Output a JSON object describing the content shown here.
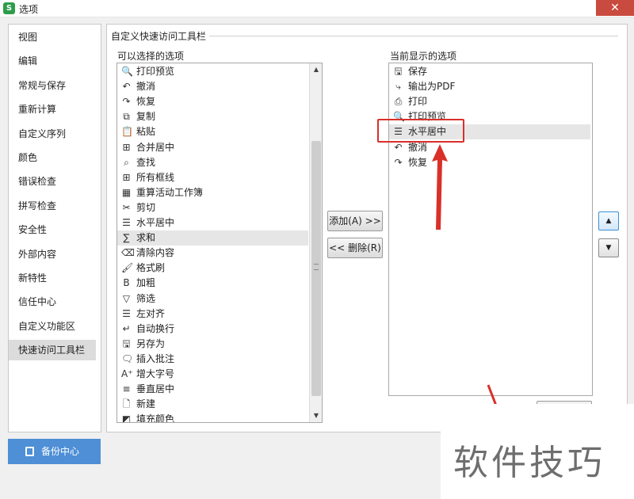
{
  "window": {
    "title": "选项",
    "app_icon_letter": "S",
    "close_glyph": "✕"
  },
  "sidebar": {
    "items": [
      {
        "label": "视图"
      },
      {
        "label": "编辑"
      },
      {
        "label": "常规与保存"
      },
      {
        "label": "重新计算"
      },
      {
        "label": "自定义序列"
      },
      {
        "label": "颜色"
      },
      {
        "label": "错误检查"
      },
      {
        "label": "拼写检查"
      },
      {
        "label": "安全性"
      },
      {
        "label": "外部内容"
      },
      {
        "label": "新特性"
      },
      {
        "label": "信任中心"
      },
      {
        "label": "自定义功能区"
      },
      {
        "label": "快速访问工具栏"
      }
    ],
    "selected_index": 13
  },
  "backup": {
    "label": "备份中心",
    "icon": "backup-icon"
  },
  "main": {
    "group_title": "自定义快速访问工具栏",
    "available_label": "可以选择的选项",
    "current_label": "当前显示的选项",
    "available_items": [
      {
        "label": "打印预览",
        "icon": "print-preview-icon",
        "glyph": "🔍"
      },
      {
        "label": "撤消",
        "icon": "undo-icon",
        "glyph": "↶"
      },
      {
        "label": "恢复",
        "icon": "redo-icon",
        "glyph": "↷"
      },
      {
        "label": "复制",
        "icon": "copy-icon",
        "glyph": "⧉"
      },
      {
        "label": "粘贴",
        "icon": "paste-icon",
        "glyph": "📋"
      },
      {
        "label": "合并居中",
        "icon": "merge-center-icon",
        "glyph": "⊞"
      },
      {
        "label": "查找",
        "icon": "find-icon",
        "glyph": "⌕"
      },
      {
        "label": "所有框线",
        "icon": "all-borders-icon",
        "glyph": "⊞"
      },
      {
        "label": "重算活动工作簿",
        "icon": "recalc-icon",
        "glyph": "▦"
      },
      {
        "label": "剪切",
        "icon": "cut-icon",
        "glyph": "✂"
      },
      {
        "label": "水平居中",
        "icon": "align-center-icon",
        "glyph": "☰"
      },
      {
        "label": "求和",
        "icon": "sum-icon",
        "glyph": "∑"
      },
      {
        "label": "清除内容",
        "icon": "clear-icon",
        "glyph": "⌫"
      },
      {
        "label": "格式刷",
        "icon": "format-painter-icon",
        "glyph": "🖌"
      },
      {
        "label": "加粗",
        "icon": "bold-icon",
        "glyph": "B"
      },
      {
        "label": "筛选",
        "icon": "filter-icon",
        "glyph": "▽"
      },
      {
        "label": "左对齐",
        "icon": "align-left-icon",
        "glyph": "☰"
      },
      {
        "label": "自动换行",
        "icon": "wrap-icon",
        "glyph": "↵"
      },
      {
        "label": "另存为",
        "icon": "save-as-icon",
        "glyph": "🖫"
      },
      {
        "label": "插入批注",
        "icon": "comment-icon",
        "glyph": "🗨"
      },
      {
        "label": "增大字号",
        "icon": "font-increase-icon",
        "glyph": "A⁺"
      },
      {
        "label": "垂直居中",
        "icon": "vertical-center-icon",
        "glyph": "≡"
      },
      {
        "label": "新建",
        "icon": "new-icon",
        "glyph": "🗋"
      },
      {
        "label": "填充颜色",
        "icon": "fill-color-icon",
        "glyph": "◩"
      }
    ],
    "available_selected_index": 11,
    "current_items": [
      {
        "label": "保存",
        "icon": "save-icon",
        "glyph": "🖫"
      },
      {
        "label": "输出为PDF",
        "icon": "export-pdf-icon",
        "glyph": "⤷"
      },
      {
        "label": "打印",
        "icon": "print-icon",
        "glyph": "⎙"
      },
      {
        "label": "打印预览",
        "icon": "print-preview-icon",
        "glyph": "🔍"
      },
      {
        "label": "水平居中",
        "icon": "align-center-icon",
        "glyph": "☰"
      },
      {
        "label": "撤消",
        "icon": "undo-icon",
        "glyph": "↶"
      },
      {
        "label": "恢复",
        "icon": "redo-icon",
        "glyph": "↷"
      }
    ],
    "current_selected_index": 4,
    "add_label": "添加(A) >>",
    "remove_label": "<< 删除(R)",
    "move_up_glyph": "▲",
    "move_down_glyph": "▼"
  },
  "watermark": {
    "text": "软件技巧"
  },
  "colors": {
    "accent": "#4e8fd6",
    "highlight": "#d9302a",
    "close": "#c94a3f"
  }
}
